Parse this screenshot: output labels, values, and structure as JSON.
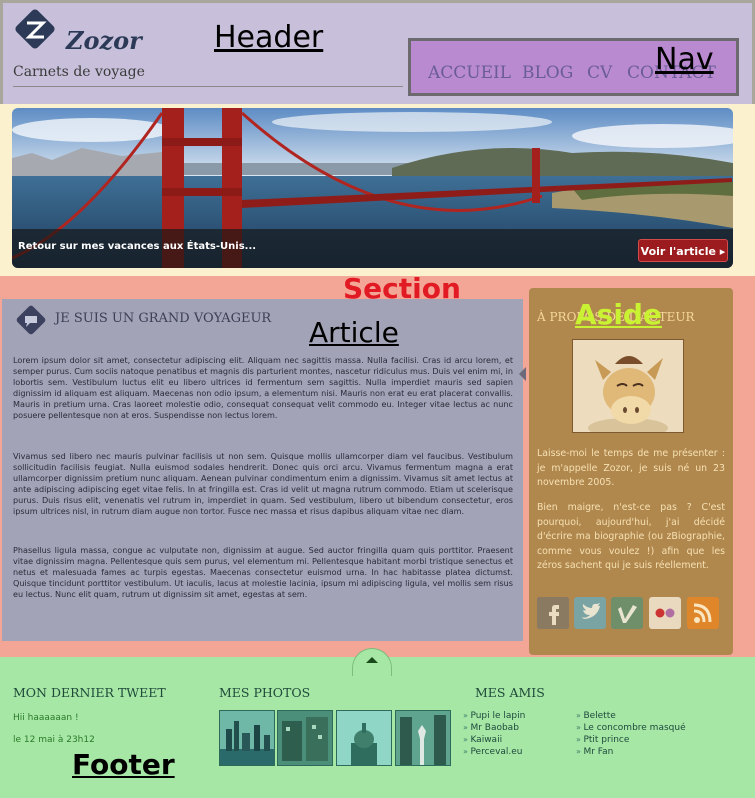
{
  "header": {
    "brand": "Zozor",
    "tagline": "Carnets de voyage",
    "annotation": "Header"
  },
  "nav": {
    "annotation": "Nav",
    "items": [
      "ACCUEIL",
      "BLOG",
      "CV",
      "CONTACT"
    ]
  },
  "hero": {
    "caption": "Retour sur mes vacances aux États-Unis...",
    "button_label": "Voir l'article"
  },
  "section": {
    "annotation": "Section"
  },
  "article": {
    "annotation": "Article",
    "title": "JE SUIS UN GRAND VOYAGEUR",
    "paragraphs": [
      "Lorem ipsum dolor sit amet, consectetur adipiscing elit. Aliquam nec sagittis massa. Nulla facilisi. Cras id arcu lorem, et semper purus. Cum sociis natoque penatibus et magnis dis parturient montes, nascetur ridiculus mus. Duis vel enim mi, in lobortis sem. Vestibulum luctus elit eu libero ultrices id fermentum sem sagittis. Nulla imperdiet mauris sed sapien dignissim id aliquam est aliquam. Maecenas non odio ipsum, a elementum nisi. Mauris non erat eu erat placerat convallis. Mauris in pretium urna. Cras laoreet molestie odio, consequat consequat velit commodo eu. Integer vitae lectus ac nunc posuere pellentesque non at eros. Suspendisse non lectus lorem.",
      "Vivamus sed libero nec mauris pulvinar facilisis ut non sem. Quisque mollis ullamcorper diam vel faucibus. Vestibulum sollicitudin facilisis feugiat. Nulla euismod sodales hendrerit. Donec quis orci arcu. Vivamus fermentum magna a erat ullamcorper dignissim pretium nunc aliquam. Aenean pulvinar condimentum enim a dignissim. Vivamus sit amet lectus at ante adipiscing adipiscing eget vitae felis. In at fringilla est. Cras id velit ut magna rutrum commodo. Etiam ut scelerisque purus. Duis risus elit, venenatis vel rutrum in, imperdiet in quam. Sed vestibulum, libero ut bibendum consectetur, eros ipsum ultrices nisl, in rutrum diam augue non tortor. Fusce nec massa et risus dapibus aliquam vitae nec diam.",
      "Phasellus ligula massa, congue ac vulputate non, dignissim at augue. Sed auctor fringilla quam quis porttitor. Praesent vitae dignissim magna. Pellentesque quis sem purus, vel elementum mi. Pellentesque habitant morbi tristique senectus et netus et malesuada fames ac turpis egestas. Maecenas consectetur euismod urna. In hac habitasse platea dictumst. Quisque tincidunt porttitor vestibulum. Ut iaculis, lacus at molestie lacinia, ipsum mi adipiscing ligula, vel mollis sem risus eu lectus. Nunc elit quam, rutrum ut dignissim sit amet, egestas at sem."
    ]
  },
  "aside": {
    "annotation": "Aside",
    "title": "À PROPOS DE L'AUTEUR",
    "paragraphs": [
      "Laisse-moi le temps de me présenter : je m'appelle Zozor, je suis né un 23 novembre 2005.",
      "Bien maigre, n'est-ce pas ? C'est pourquoi, aujourd'hui, j'ai décidé d'écrire ma biographie (ou zBiographie, comme vous voulez !) afin que les zéros sachent qui je suis réellement."
    ],
    "social": [
      "facebook-icon",
      "twitter-icon",
      "vimeo-icon",
      "flickr-icon",
      "rss-icon"
    ]
  },
  "footer": {
    "annotation": "Footer",
    "tweet_title": "MON DERNIER TWEET",
    "tweet_text": "Hii haaaaaan !",
    "tweet_date": "le 12 mai à 23h12",
    "photos_title": "MES PHOTOS",
    "friends_title": "MES AMIS",
    "friends_col1": [
      "Pupi le lapin",
      "Mr Baobab",
      "Kaiwaii",
      "Perceval.eu"
    ],
    "friends_col2": [
      "Belette",
      "Le concombre masqué",
      "Ptit prince",
      "Mr Fan"
    ]
  },
  "colors": {
    "header_bg": "#c8c0db",
    "nav_bg": "#b98ad0",
    "section_bg": "#f3a596",
    "article_bg": "#a3a3b8",
    "aside_bg": "#b0874d",
    "footer_bg": "#a7e7a5",
    "hero_button": "#9c1b1f"
  }
}
